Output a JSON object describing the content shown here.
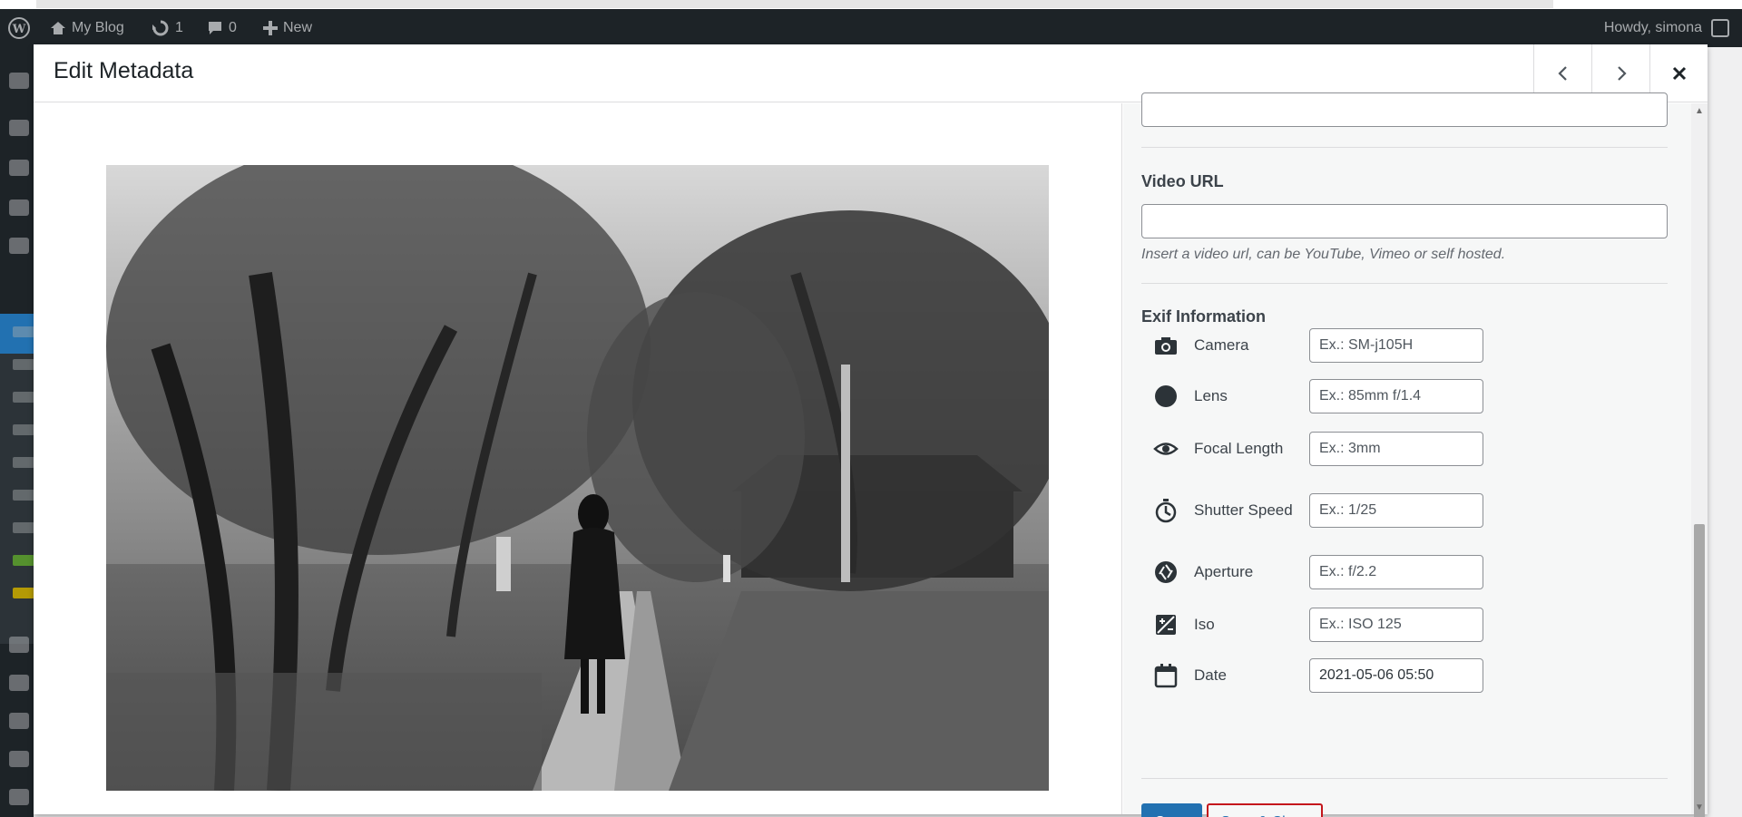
{
  "adminbar": {
    "site_name": "My Blog",
    "updates_count": "1",
    "comments_count": "0",
    "new_label": "New",
    "howdy": "Howdy, simona"
  },
  "modal": {
    "title": "Edit Metadata",
    "prev_icon": "chevron-left-icon",
    "next_icon": "chevron-right-icon",
    "close_icon": "close-icon"
  },
  "video": {
    "label": "Video URL",
    "value": "",
    "help": "Insert a video url, can be YouTube, Vimeo or self hosted."
  },
  "exif": {
    "heading": "Exif Information",
    "fields": [
      {
        "label": "Camera",
        "icon": "camera-icon",
        "placeholder": "Ex.: SM-j105H",
        "value": ""
      },
      {
        "label": "Lens",
        "icon": "lens-icon",
        "placeholder": "Ex.: 85mm f/1.4",
        "value": ""
      },
      {
        "label": "Focal Length",
        "icon": "eye-icon",
        "placeholder": "Ex.: 3mm",
        "value": ""
      },
      {
        "label": "Shutter Speed",
        "icon": "stopwatch-icon",
        "placeholder": "Ex.: 1/25",
        "value": ""
      },
      {
        "label": "Aperture",
        "icon": "aperture-icon",
        "placeholder": "Ex.: f/2.2",
        "value": ""
      },
      {
        "label": "Iso",
        "icon": "iso-icon",
        "placeholder": "Ex.: ISO 125",
        "value": ""
      },
      {
        "label": "Date",
        "icon": "calendar-icon",
        "placeholder": "",
        "value": "2021-05-06 05:50"
      }
    ]
  },
  "actions": {
    "save": "Save",
    "save_close": "Save & Close"
  },
  "colors": {
    "accent": "#2271b1",
    "adminbar": "#1d2327",
    "highlight_border": "#c4161c"
  }
}
